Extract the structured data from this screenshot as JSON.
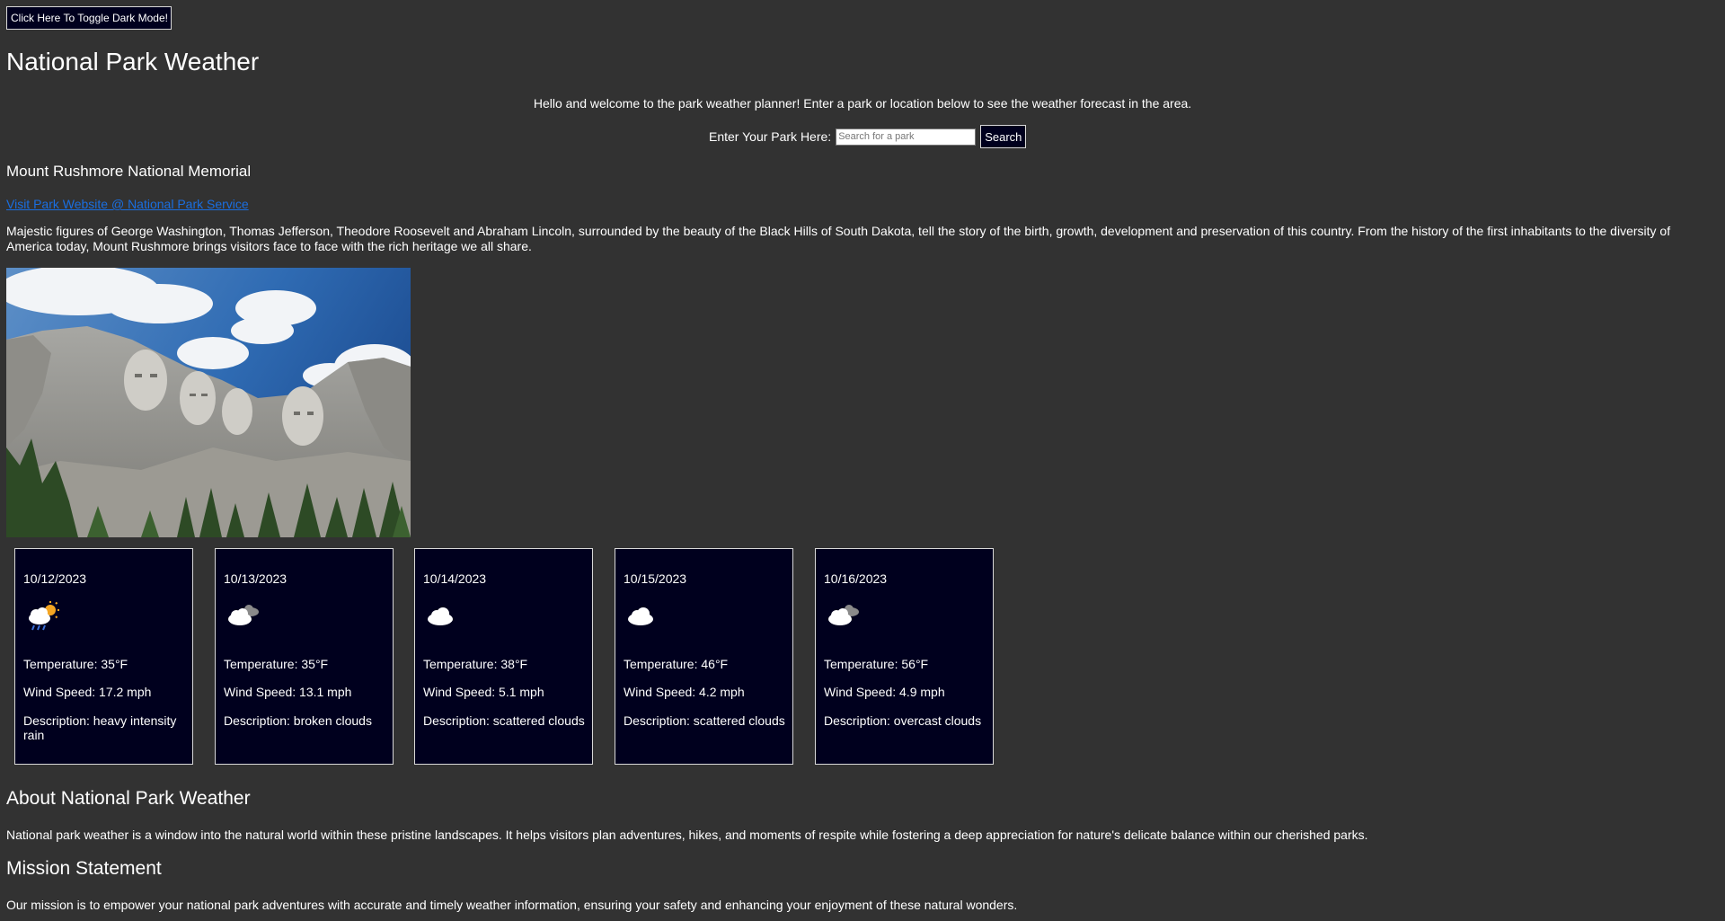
{
  "header": {
    "toggle_label": "Click Here To Toggle Dark Mode!",
    "title": "National Park Weather",
    "welcome": "Hello and welcome to the park weather planner! Enter a park or location below to see the weather forecast in the area."
  },
  "search": {
    "label": "Enter Your Park Here:",
    "placeholder": "Search for a park",
    "value": "",
    "button_label": "Search"
  },
  "park": {
    "name": "Mount Rushmore National Memorial",
    "link_text": "Visit Park Website @ National Park Service",
    "description": "Majestic figures of George Washington, Thomas Jefferson, Theodore Roosevelt and Abraham Lincoln, surrounded by the beauty of the Black Hills of South Dakota, tell the story of the birth, growth, development and preservation of this country. From the history of the first inhabitants to the diversity of America today, Mount Rushmore brings visitors face to face with the rich heritage we all share.",
    "photo_icon": "mount-rushmore-photo"
  },
  "forecast": [
    {
      "date": "10/12/2023",
      "icon": "rain-sun-icon",
      "temperature": "Temperature: 35°F",
      "wind": "Wind Speed: 17.2 mph",
      "description": "Description: heavy intensity rain"
    },
    {
      "date": "10/13/2023",
      "icon": "broken-clouds-icon",
      "temperature": "Temperature: 35°F",
      "wind": "Wind Speed: 13.1 mph",
      "description": "Description: broken clouds"
    },
    {
      "date": "10/14/2023",
      "icon": "scattered-clouds-icon",
      "temperature": "Temperature: 38°F",
      "wind": "Wind Speed: 5.1 mph",
      "description": "Description: scattered clouds"
    },
    {
      "date": "10/15/2023",
      "icon": "scattered-clouds-icon",
      "temperature": "Temperature: 46°F",
      "wind": "Wind Speed: 4.2 mph",
      "description": "Description: scattered clouds"
    },
    {
      "date": "10/16/2023",
      "icon": "overcast-clouds-icon",
      "temperature": "Temperature: 56°F",
      "wind": "Wind Speed: 4.9 mph",
      "description": "Description: overcast clouds"
    }
  ],
  "about": {
    "title": "About National Park Weather",
    "text": "National park weather is a window into the natural world within these pristine landscapes. It helps visitors plan adventures, hikes, and moments of respite while fostering a deep appreciation for nature's delicate balance within our cherished parks."
  },
  "mission": {
    "title": "Mission Statement",
    "text": "Our mission is to empower your national park adventures with accurate and timely weather information, ensuring your safety and enhancing your enjoyment of these natural wonders."
  },
  "colors": {
    "page_background": "#323232",
    "card_background": "#00001e",
    "link": "#1a6ee0",
    "text": "#ffffff"
  }
}
